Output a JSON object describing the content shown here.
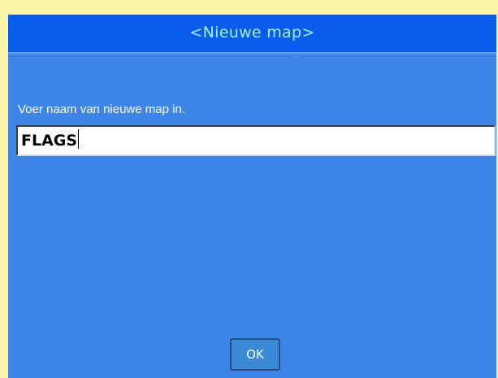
{
  "dialog": {
    "title": "<Nieuwe map>",
    "prompt": "Voer naam van nieuwe map in.",
    "input_value": "FLAGS",
    "ok_label": "OK"
  },
  "colors": {
    "title_bar": "#0a5cec",
    "title_text": "#9ff2f2",
    "dialog_background": "#3d86e8",
    "screen_border": "#fbf5a8"
  }
}
